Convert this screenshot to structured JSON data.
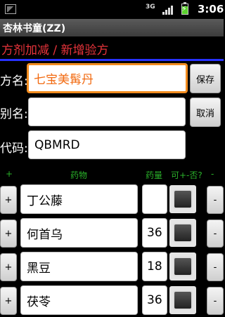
{
  "status_bar": {
    "network": "3G",
    "time": "3:06",
    "icons": [
      "notification-icon",
      "signal-icon",
      "battery-charging-icon"
    ]
  },
  "app": {
    "title": "杏林书童(ZZ)",
    "subtitle": "方剂加减 / 新增验方",
    "accent_color": "#e8343b",
    "divider_color": "#2732ff"
  },
  "form": {
    "name_label": "方名:",
    "name_value": "七宝美髯丹",
    "alias_label": "别名:",
    "alias_value": "",
    "code_label": "代码:",
    "code_value": "QBMRD",
    "save_label": "保存",
    "cancel_label": "取消"
  },
  "list_header": {
    "plus": "+",
    "drug": "药物",
    "dose": "药量",
    "option": "可+-否?",
    "minus": "-"
  },
  "rows": [
    {
      "plus": "+",
      "name": "丁公藤",
      "qty": "",
      "checked": false,
      "minus": "-"
    },
    {
      "plus": "+",
      "name": "何首乌",
      "qty": "36",
      "checked": false,
      "minus": "-"
    },
    {
      "plus": "+",
      "name": "黑豆",
      "qty": "18",
      "checked": false,
      "minus": "-"
    },
    {
      "plus": "+",
      "name": "茯苓",
      "qty": "36",
      "checked": false,
      "minus": "-"
    }
  ]
}
